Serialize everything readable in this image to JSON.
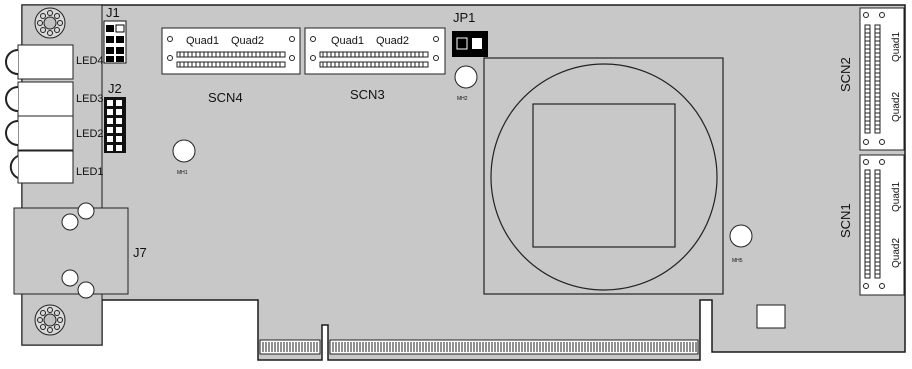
{
  "colors": {
    "board": "#c8c8c8",
    "outline": "#1a1a1a",
    "connector": "#ffffff",
    "jumper": "#000000"
  },
  "labels": {
    "j1": "J1",
    "j2": "J2",
    "jp1": "JP1",
    "j7": "J7",
    "led1": "LED1",
    "led2": "LED2",
    "led3": "LED3",
    "led4": "LED4",
    "scn1": "SCN1",
    "scn2": "SCN2",
    "scn3": "SCN3",
    "scn4": "SCN4",
    "mh1": "MH1",
    "mh2": "MH2",
    "mh5": "MH5",
    "quad1": "Quad1",
    "quad2": "Quad2"
  },
  "icons": {
    "mounting_hole": "mounting-hole-icon",
    "bracket_screw": "gear-icon"
  }
}
